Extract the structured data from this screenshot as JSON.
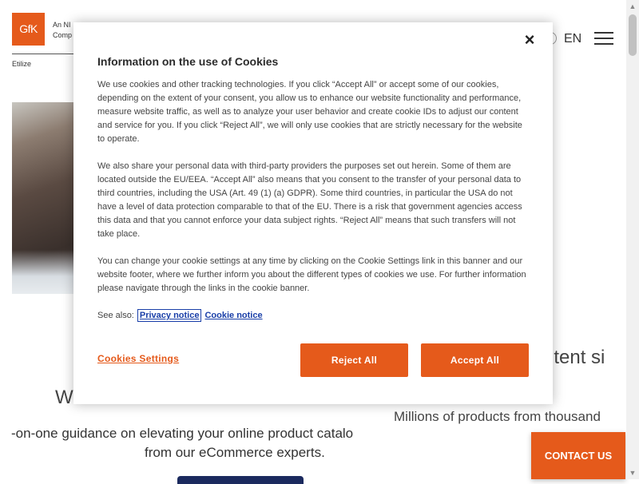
{
  "header": {
    "logo_text": "GfK",
    "logo_tagline_1": "An NI",
    "logo_tagline_2": "Comp",
    "brand_sub": "Etilize",
    "language": "EN"
  },
  "page": {
    "heading_left": "W",
    "heading_right": "ntent si",
    "millions_text": "Millions of products from thousand",
    "guidance_line1": "-on-one guidance on elevating your online product catalo",
    "guidance_line2": "from our eCommerce experts.",
    "contact_label": "CONTACT US"
  },
  "cookie_modal": {
    "close_label": "×",
    "title": "Information on the use of Cookies",
    "paragraphs": [
      "We use cookies and other tracking technologies. If you click “Accept All” or accept some of our cookies, depending on the extent of your consent, you allow us to enhance our website functionality and performance, measure website traffic, as well as to analyze your user behavior and create cookie IDs to adjust our content and service for you. If you click “Reject All”, we will only use cookies that are strictly necessary for the website to operate.",
      "We also share your personal data with third-party providers the purposes set out herein. Some of them are located outside the EU/EEA. “Accept All” also means that you consent to the transfer of your personal data to third countries, including the USA (Art. 49 (1) (a) GDPR). Some third countries, in particular the USA do not have a level of data protection comparable to that of the EU. There is a risk that government agencies access this data and that you cannot enforce your data subject rights. “Reject All” means that such transfers will not take place.",
      "You can change your cookie settings at any time by clicking on the Cookie Settings link in this banner and our website footer, where we further inform you about the different types of cookies we use. For further information please navigate through the links in the cookie banner."
    ],
    "see_also_label": "See also:",
    "privacy_link": "Privacy notice",
    "cookie_link": "Cookie notice",
    "settings_link": "Cookies Settings",
    "reject_label": "Reject All",
    "accept_label": "Accept All"
  },
  "colors": {
    "brand_orange": "#e55a1b",
    "link_blue": "#1a3fa8",
    "dark_navy": "#1b2a5e"
  }
}
